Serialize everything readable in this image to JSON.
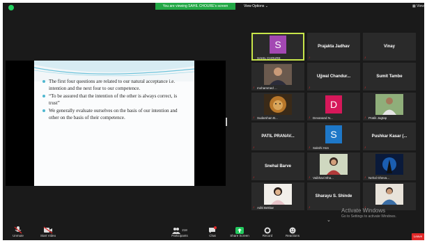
{
  "topbar": {
    "banner": "You are viewing SAHIL CHOURE's screen",
    "view_options": "View Options ⌄",
    "view": "View"
  },
  "slide": {
    "bullets": [
      "The first four questions are related to our natural acceptance i.e. intention and the next four to our competence.",
      "“To be assured that the intention of the other is always correct, is trust”",
      "We generally evaluate ourselves on the basis of our intention and other on the basis of their competence."
    ]
  },
  "participants": [
    {
      "name": "",
      "label": "SAHIL CHOURE",
      "avatar": "S",
      "color": "#a348b3",
      "active": true,
      "muted": false
    },
    {
      "name": "Prajakta Jadhav",
      "label": "",
      "muted": true
    },
    {
      "name": "Vinay",
      "label": "",
      "muted": true
    },
    {
      "name": "",
      "label": "mohammed ...",
      "photo": "person",
      "muted": true
    },
    {
      "name": "Ujjwal Chandur...",
      "label": "",
      "muted": true
    },
    {
      "name": "Sumit Tambe",
      "label": "",
      "muted": true
    },
    {
      "name": "",
      "label": "Sudarshan B...",
      "photo": "lion",
      "muted": true
    },
    {
      "name": "",
      "label": "Devanand N...",
      "avatar": "D",
      "color": "#d6185a",
      "muted": true
    },
    {
      "name": "",
      "label": "Pratik Jagtap",
      "photo": "person2",
      "muted": true
    },
    {
      "name": "PATIL PRANAV...",
      "label": "",
      "muted": true
    },
    {
      "name": "",
      "label": "Sakshi Hon",
      "avatar": "S",
      "color": "#1e78c8",
      "muted": true
    },
    {
      "name": "Pushkar Kasar (...",
      "label": "",
      "muted": true
    },
    {
      "name": "Snehal Barve",
      "label": "",
      "muted": true
    },
    {
      "name": "",
      "label": "Vaibhavi Bha...",
      "photo": "woman",
      "muted": true
    },
    {
      "name": "",
      "label": "Nehal Gheva...",
      "photo": "blue",
      "muted": true
    },
    {
      "name": "",
      "label": "Aditi Bekkar",
      "photo": "woman2",
      "muted": true
    },
    {
      "name": "Sharayu S. Shinde",
      "label": "",
      "muted": true
    },
    {
      "name": "",
      "label": "",
      "photo": "person3",
      "muted": true
    }
  ],
  "watermark": {
    "title": "Activate Windows",
    "subtitle": "Go to Settings to activate Windows."
  },
  "toolbar": {
    "unmute": "Unmute",
    "start_video": "Start Video",
    "participants": "Participants",
    "participant_count": "218",
    "chat": "Chat",
    "share_screen": "Share Screen",
    "record": "Record",
    "reactions": "Reactions",
    "leave": "Leave"
  },
  "colors": {
    "banner": "#23a846",
    "active_border": "#c8e64a",
    "muted_icon": "#e02828",
    "leave": "#e02828",
    "slide_accent": "#4fb7d0"
  }
}
